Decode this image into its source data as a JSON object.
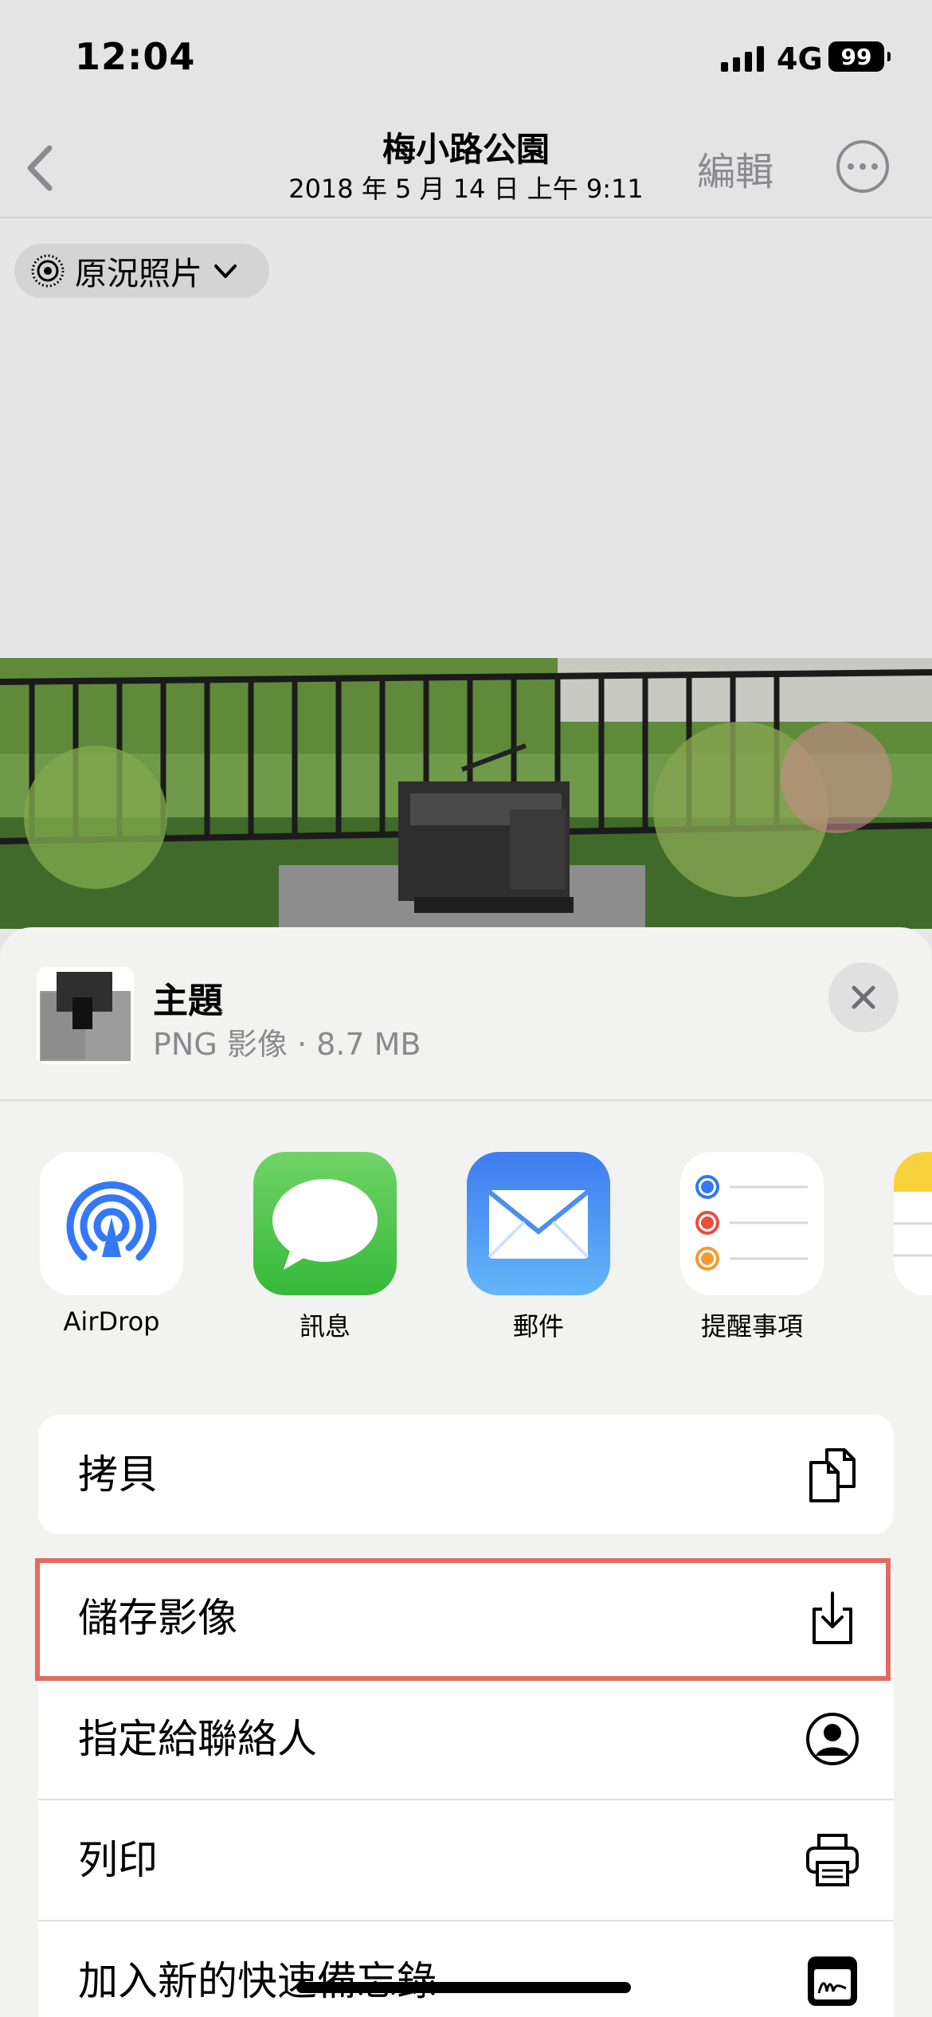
{
  "status_bar": {
    "time": "12:04",
    "network": "4G",
    "battery": "99"
  },
  "nav": {
    "title": "梅小路公園",
    "subtitle": "2018 年 5 月 14 日  上午 9:11",
    "edit_label": "編輯"
  },
  "live_photo": {
    "label": "原況照片"
  },
  "share_sheet": {
    "title": "主題",
    "subtitle": "PNG 影像 · 8.7 MB",
    "apps": [
      {
        "label": "AirDrop",
        "icon": "airdrop-icon"
      },
      {
        "label": "訊息",
        "icon": "messages-icon"
      },
      {
        "label": "郵件",
        "icon": "mail-icon"
      },
      {
        "label": "提醒事項",
        "icon": "reminders-icon"
      }
    ],
    "actions": [
      {
        "label": "拷貝",
        "icon": "copy-icon"
      },
      {
        "label": "儲存影像",
        "icon": "save-image-icon"
      },
      {
        "label": "指定給聯絡人",
        "icon": "assign-contact-icon"
      },
      {
        "label": "列印",
        "icon": "printer-icon"
      },
      {
        "label": "加入新的快速備忘錄",
        "icon": "quick-note-icon"
      }
    ]
  },
  "colors": {
    "highlight": "#e06c61",
    "system_blue": "#3478f6",
    "sheet_bg": "#f2f2f0"
  }
}
